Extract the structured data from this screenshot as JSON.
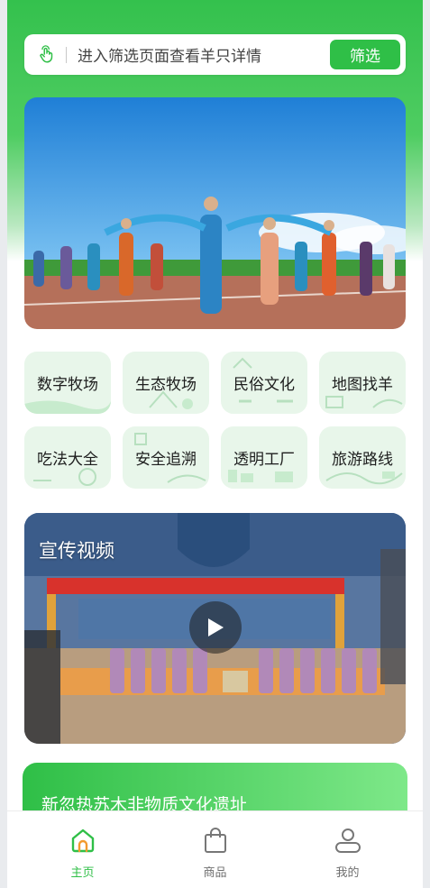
{
  "search": {
    "placeholder": "进入筛选页面查看羊只详情",
    "button_label": "筛选",
    "icon": "pointer-hand-icon"
  },
  "banner": {
    "description_icon": "banner-image"
  },
  "categories": [
    {
      "label": "数字牧场",
      "icon": "digital-ranch-icon"
    },
    {
      "label": "生态牧场",
      "icon": "eco-ranch-icon"
    },
    {
      "label": "民俗文化",
      "icon": "folk-culture-icon"
    },
    {
      "label": "地图找羊",
      "icon": "map-find-sheep-icon"
    },
    {
      "label": "吃法大全",
      "icon": "recipes-icon"
    },
    {
      "label": "安全追溯",
      "icon": "traceability-icon"
    },
    {
      "label": "透明工厂",
      "icon": "transparent-factory-icon"
    },
    {
      "label": "旅游路线",
      "icon": "travel-route-icon"
    }
  ],
  "video": {
    "title": "宣传视频"
  },
  "heritage_card": {
    "title": "新忽热苏木非物质文化遗址"
  },
  "tabbar": {
    "items": [
      {
        "label": "主页",
        "icon": "home-icon",
        "active": true
      },
      {
        "label": "商品",
        "icon": "shopping-bag-icon",
        "active": false
      },
      {
        "label": "我的",
        "icon": "user-icon",
        "active": false
      }
    ]
  },
  "colors": {
    "brand_green": "#2fbf47",
    "tile_bg": "#e8f6ea",
    "inactive_text": "#6f6f6f"
  }
}
